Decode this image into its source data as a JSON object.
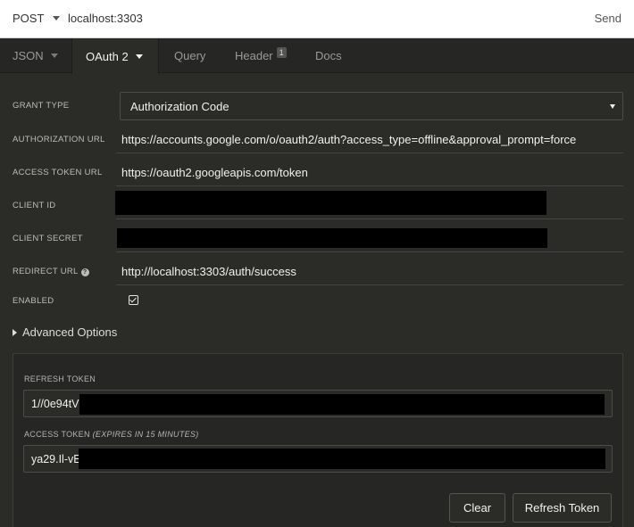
{
  "urlbar": {
    "method": "POST",
    "url": "localhost:3303",
    "send_label": "Send"
  },
  "tabs": [
    {
      "label": "JSON"
    },
    {
      "label": "OAuth 2"
    },
    {
      "label": "Query"
    },
    {
      "label": "Header",
      "badge": "1"
    },
    {
      "label": "Docs"
    }
  ],
  "form": {
    "grant_type_label": "GRANT TYPE",
    "grant_type_value": "Authorization Code",
    "auth_url_label": "AUTHORIZATION URL",
    "auth_url_value": "https://accounts.google.com/o/oauth2/auth?access_type=offline&approval_prompt=force",
    "token_url_label": "ACCESS TOKEN URL",
    "token_url_value": "https://oauth2.googleapis.com/token",
    "client_id_label": "CLIENT ID",
    "client_secret_label": "CLIENT SECRET",
    "redirect_url_label": "REDIRECT URL",
    "redirect_url_value": "http://localhost:3303/auth/success",
    "enabled_label": "ENABLED",
    "enabled_checked": true
  },
  "advanced": {
    "label": "Advanced Options"
  },
  "tokens": {
    "refresh_label": "REFRESH TOKEN",
    "refresh_value": "1//0e94tV",
    "access_label": "ACCESS TOKEN",
    "access_note": "(EXPIRES IN 15 MINUTES)",
    "access_value": "ya29.Il-vE"
  },
  "buttons": {
    "clear": "Clear",
    "refresh": "Refresh Token"
  },
  "icons": {
    "method_dropdown": "chevron-down-icon",
    "help": "help-icon",
    "check": "checkmark-icon",
    "expand": "triangle-right-icon"
  }
}
